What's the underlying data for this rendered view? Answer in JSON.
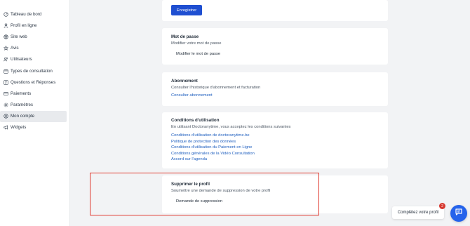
{
  "sidebar": {
    "items": [
      {
        "label": "Tableau de bord",
        "icon": "dashboard-icon"
      },
      {
        "label": "Profil en ligne",
        "icon": "user-icon"
      },
      {
        "label": "Site web",
        "icon": "globe-icon"
      },
      {
        "label": "Avis",
        "icon": "star-icon"
      },
      {
        "label": "Utilisateurs",
        "icon": "users-icon"
      },
      {
        "label": "Types de consultation",
        "icon": "calendar-icon"
      },
      {
        "label": "Questions et Réponses",
        "icon": "qa-icon"
      },
      {
        "label": "Paiements",
        "icon": "card-icon"
      },
      {
        "label": "Paramètres",
        "icon": "gear-icon"
      },
      {
        "label": "Mon compte",
        "icon": "account-icon",
        "active": true
      },
      {
        "label": "Widgets",
        "icon": "megaphone-icon"
      }
    ]
  },
  "save_card": {
    "button_label": "Enregistrer"
  },
  "password_card": {
    "title": "Mot de passe",
    "subtitle": "Modifier votre mot de passe",
    "button_label": "Modifier le mot de passe"
  },
  "subscription_card": {
    "title": "Abonnement",
    "subtitle": "Consulter l'historique d'abonnement et facturation",
    "link_label": "Consulter abonnement"
  },
  "terms_card": {
    "title": "Conditions d'utilisation",
    "subtitle": "En utilisant Doctoranytime, vous acceptez les conditions suivantes",
    "links": [
      "Conditions d'utilisation de doctoranytime.be",
      "Politique de protection des données",
      "Conditions d'utilisation du Paiement en Ligne",
      "Conditions générales de la Vidéo Consultation",
      "Accord sur l'agenda"
    ]
  },
  "delete_card": {
    "title": "Supprimer le profil",
    "subtitle": "Soumettre une demande de suppression de votre profil",
    "button_label": "Demande de suppression"
  },
  "profile_widget": {
    "label": "Complétez votre profil",
    "badge": "2"
  },
  "colors": {
    "primary": "#1f4fd1",
    "link": "#1f5fbf",
    "highlight": "#e03a2f",
    "badge": "#d6382f",
    "chat": "#2563eb"
  }
}
